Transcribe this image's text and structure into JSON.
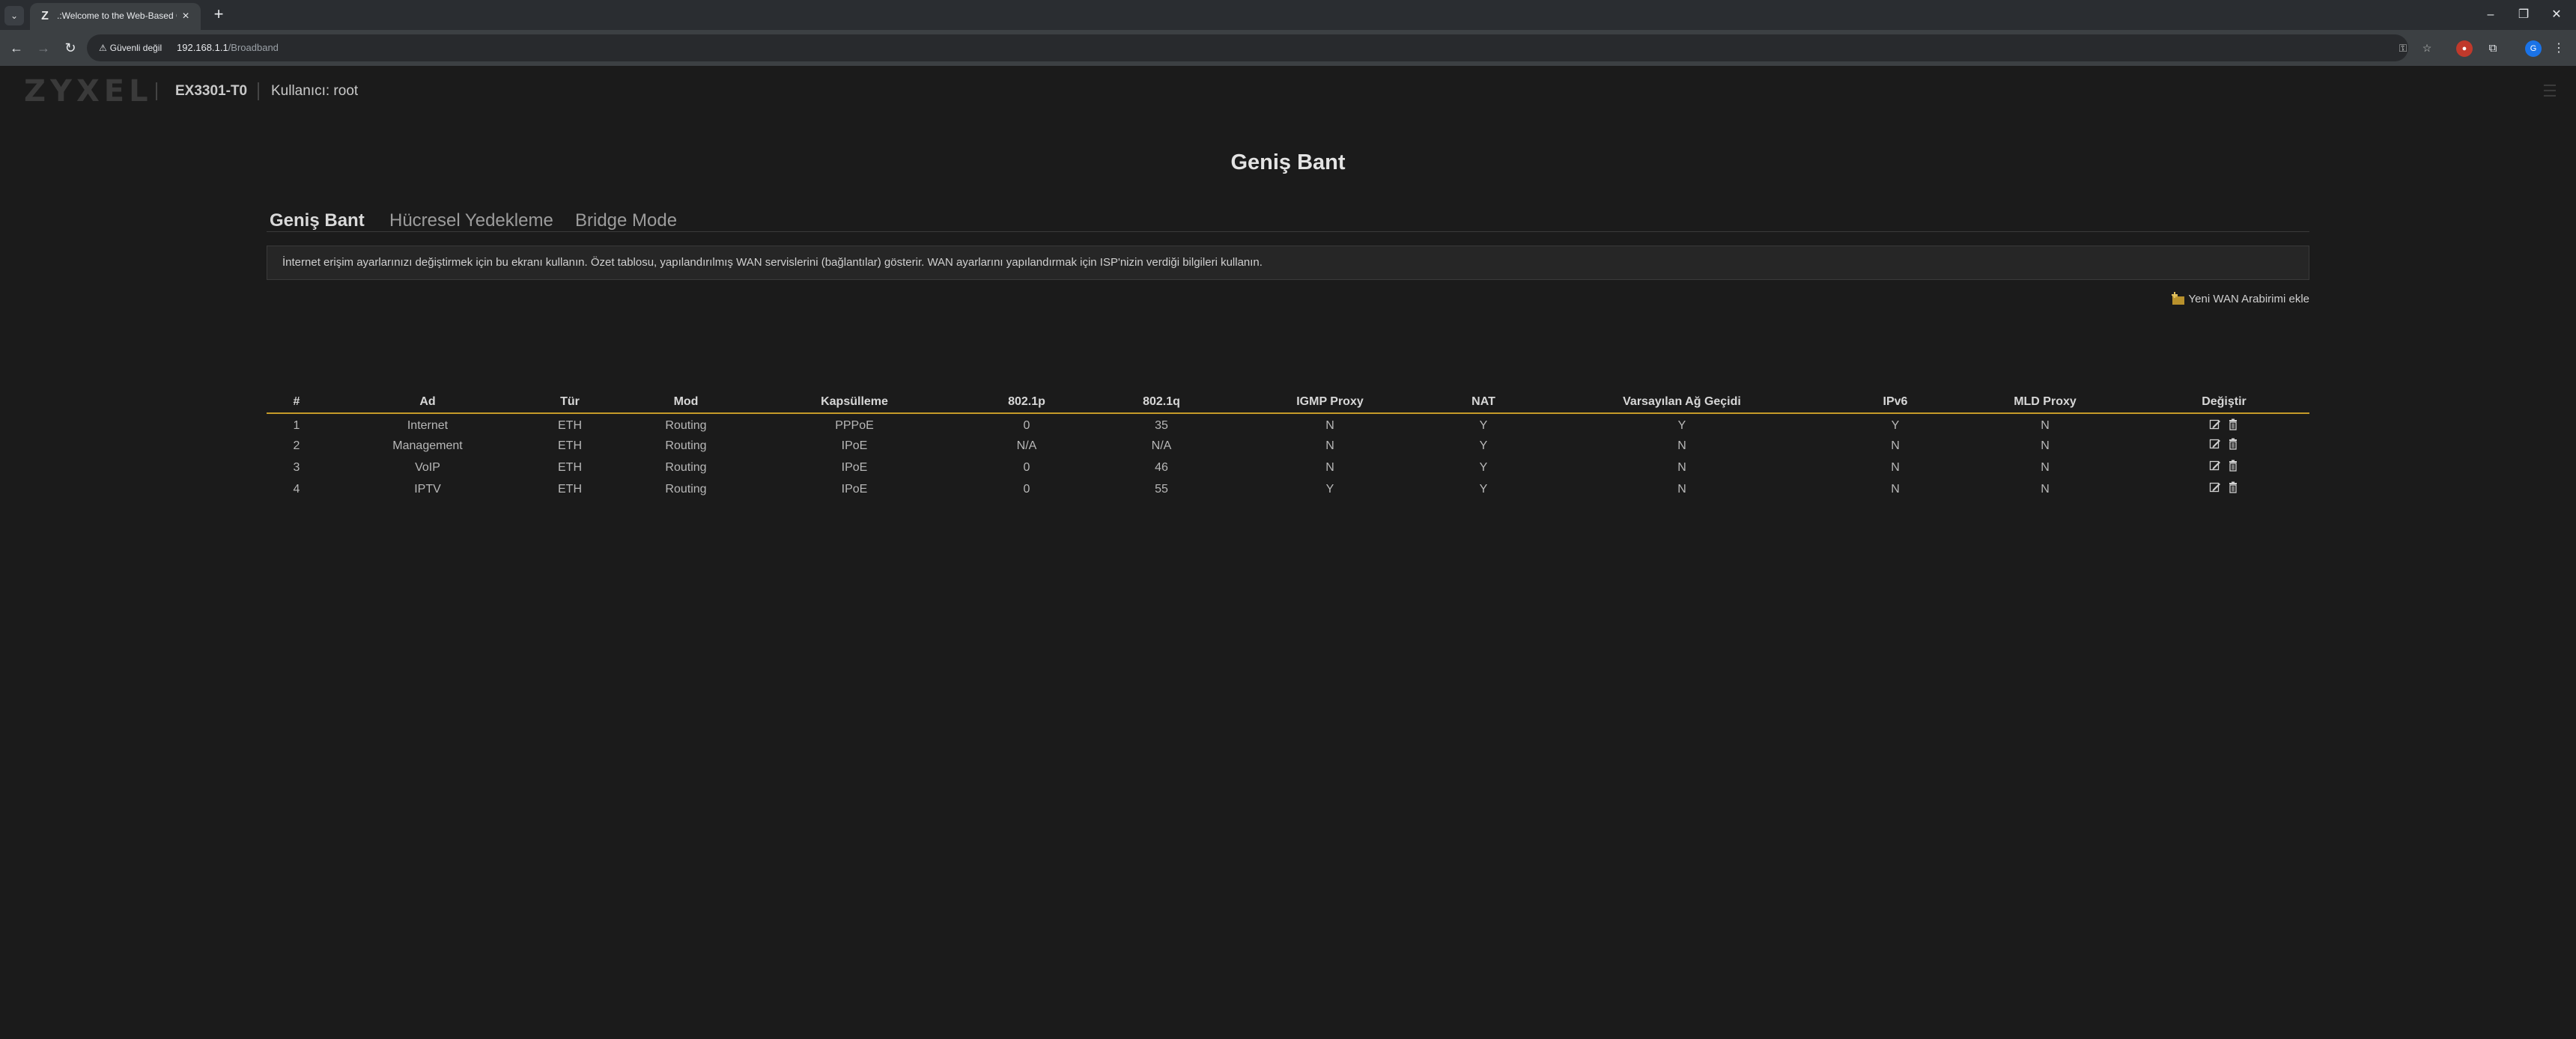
{
  "browser": {
    "tab_title": ".:Welcome to the Web-Based C",
    "tab_favicon": "Z",
    "security_label": "Güvenli değil",
    "url_host": "192.168.1.1",
    "url_path": "/Broadband",
    "profile_initial": "G"
  },
  "header": {
    "logo": "ZYXEL",
    "model": "EX3301-T0",
    "user": "Kullanıcı: root"
  },
  "page": {
    "title": "Geniş Bant",
    "tabs": [
      {
        "label": "Geniş Bant",
        "active": true
      },
      {
        "label": "Hücresel Yedekleme",
        "active": false
      },
      {
        "label": "Bridge Mode",
        "active": false
      }
    ],
    "info": "İnternet erişim ayarlarınızı değiştirmek için bu ekranı kullanın. Özet tablosu, yapılandırılmış WAN servislerini (bağlantılar) gösterir. WAN ayarlarını yapılandırmak için ISP'nizin verdiği bilgileri kullanın.",
    "add_wan": "Yeni WAN Arabirimi ekle"
  },
  "table": {
    "headers": [
      "#",
      "Ad",
      "Tür",
      "Mod",
      "Kapsülleme",
      "802.1p",
      "802.1q",
      "IGMP Proxy",
      "NAT",
      "Varsayılan Ağ Geçidi",
      "IPv6",
      "MLD Proxy",
      "Değiştir"
    ],
    "rows": [
      [
        "1",
        "Internet",
        "ETH",
        "Routing",
        "PPPoE",
        "0",
        "35",
        "N",
        "Y",
        "Y",
        "Y",
        "N"
      ],
      [
        "2",
        "Management",
        "ETH",
        "Routing",
        "IPoE",
        "N/A",
        "N/A",
        "N",
        "Y",
        "N",
        "N",
        "N"
      ],
      [
        "3",
        "VoIP",
        "ETH",
        "Routing",
        "IPoE",
        "0",
        "46",
        "N",
        "Y",
        "N",
        "N",
        "N"
      ],
      [
        "4",
        "IPTV",
        "ETH",
        "Routing",
        "IPoE",
        "0",
        "55",
        "Y",
        "Y",
        "N",
        "N",
        "N"
      ]
    ]
  },
  "colors": {
    "accent": "#c59a29",
    "background": "#1b1b1b"
  }
}
